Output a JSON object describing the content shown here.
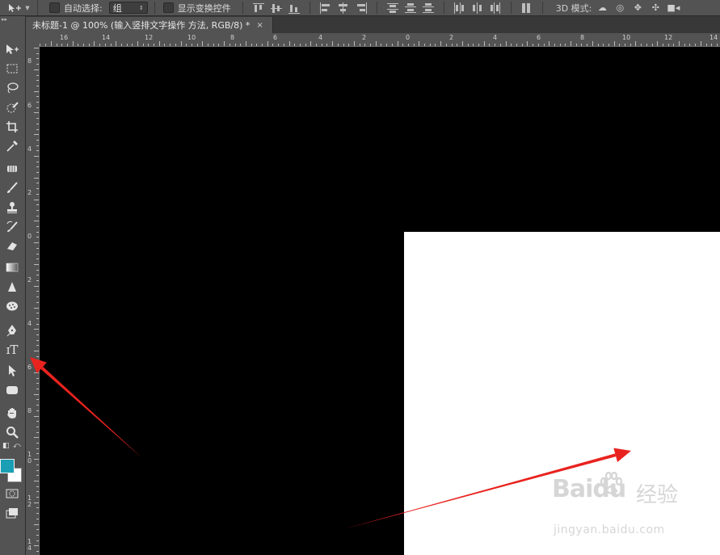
{
  "options_bar": {
    "auto_select_label": "自动选择:",
    "auto_select_value": "组",
    "show_transform_label": "显示变换控件",
    "mode_3d_label": "3D 模式:"
  },
  "document_tab": {
    "title": "未标题-1 @ 100% (输入竖排文字操作 方法, RGB/8) *",
    "close": "×"
  },
  "rulers": {
    "horizontal": [
      "16",
      "14",
      "12",
      "10",
      "8",
      "6",
      "4",
      "2",
      "0",
      "2",
      "4",
      "6",
      "8",
      "10",
      "12",
      "14"
    ],
    "vertical": [
      "8",
      "6",
      "4",
      "2",
      "0",
      "2",
      "4",
      "6",
      "8",
      "1 0",
      "1 2",
      "1 4"
    ]
  },
  "colors": {
    "foreground": "#1a9fb4",
    "background": "#ffffff",
    "arrow": "#e8231f"
  },
  "watermark": {
    "logo": "Baidu",
    "brand": "经验",
    "url": "jingyan.baidu.com"
  }
}
